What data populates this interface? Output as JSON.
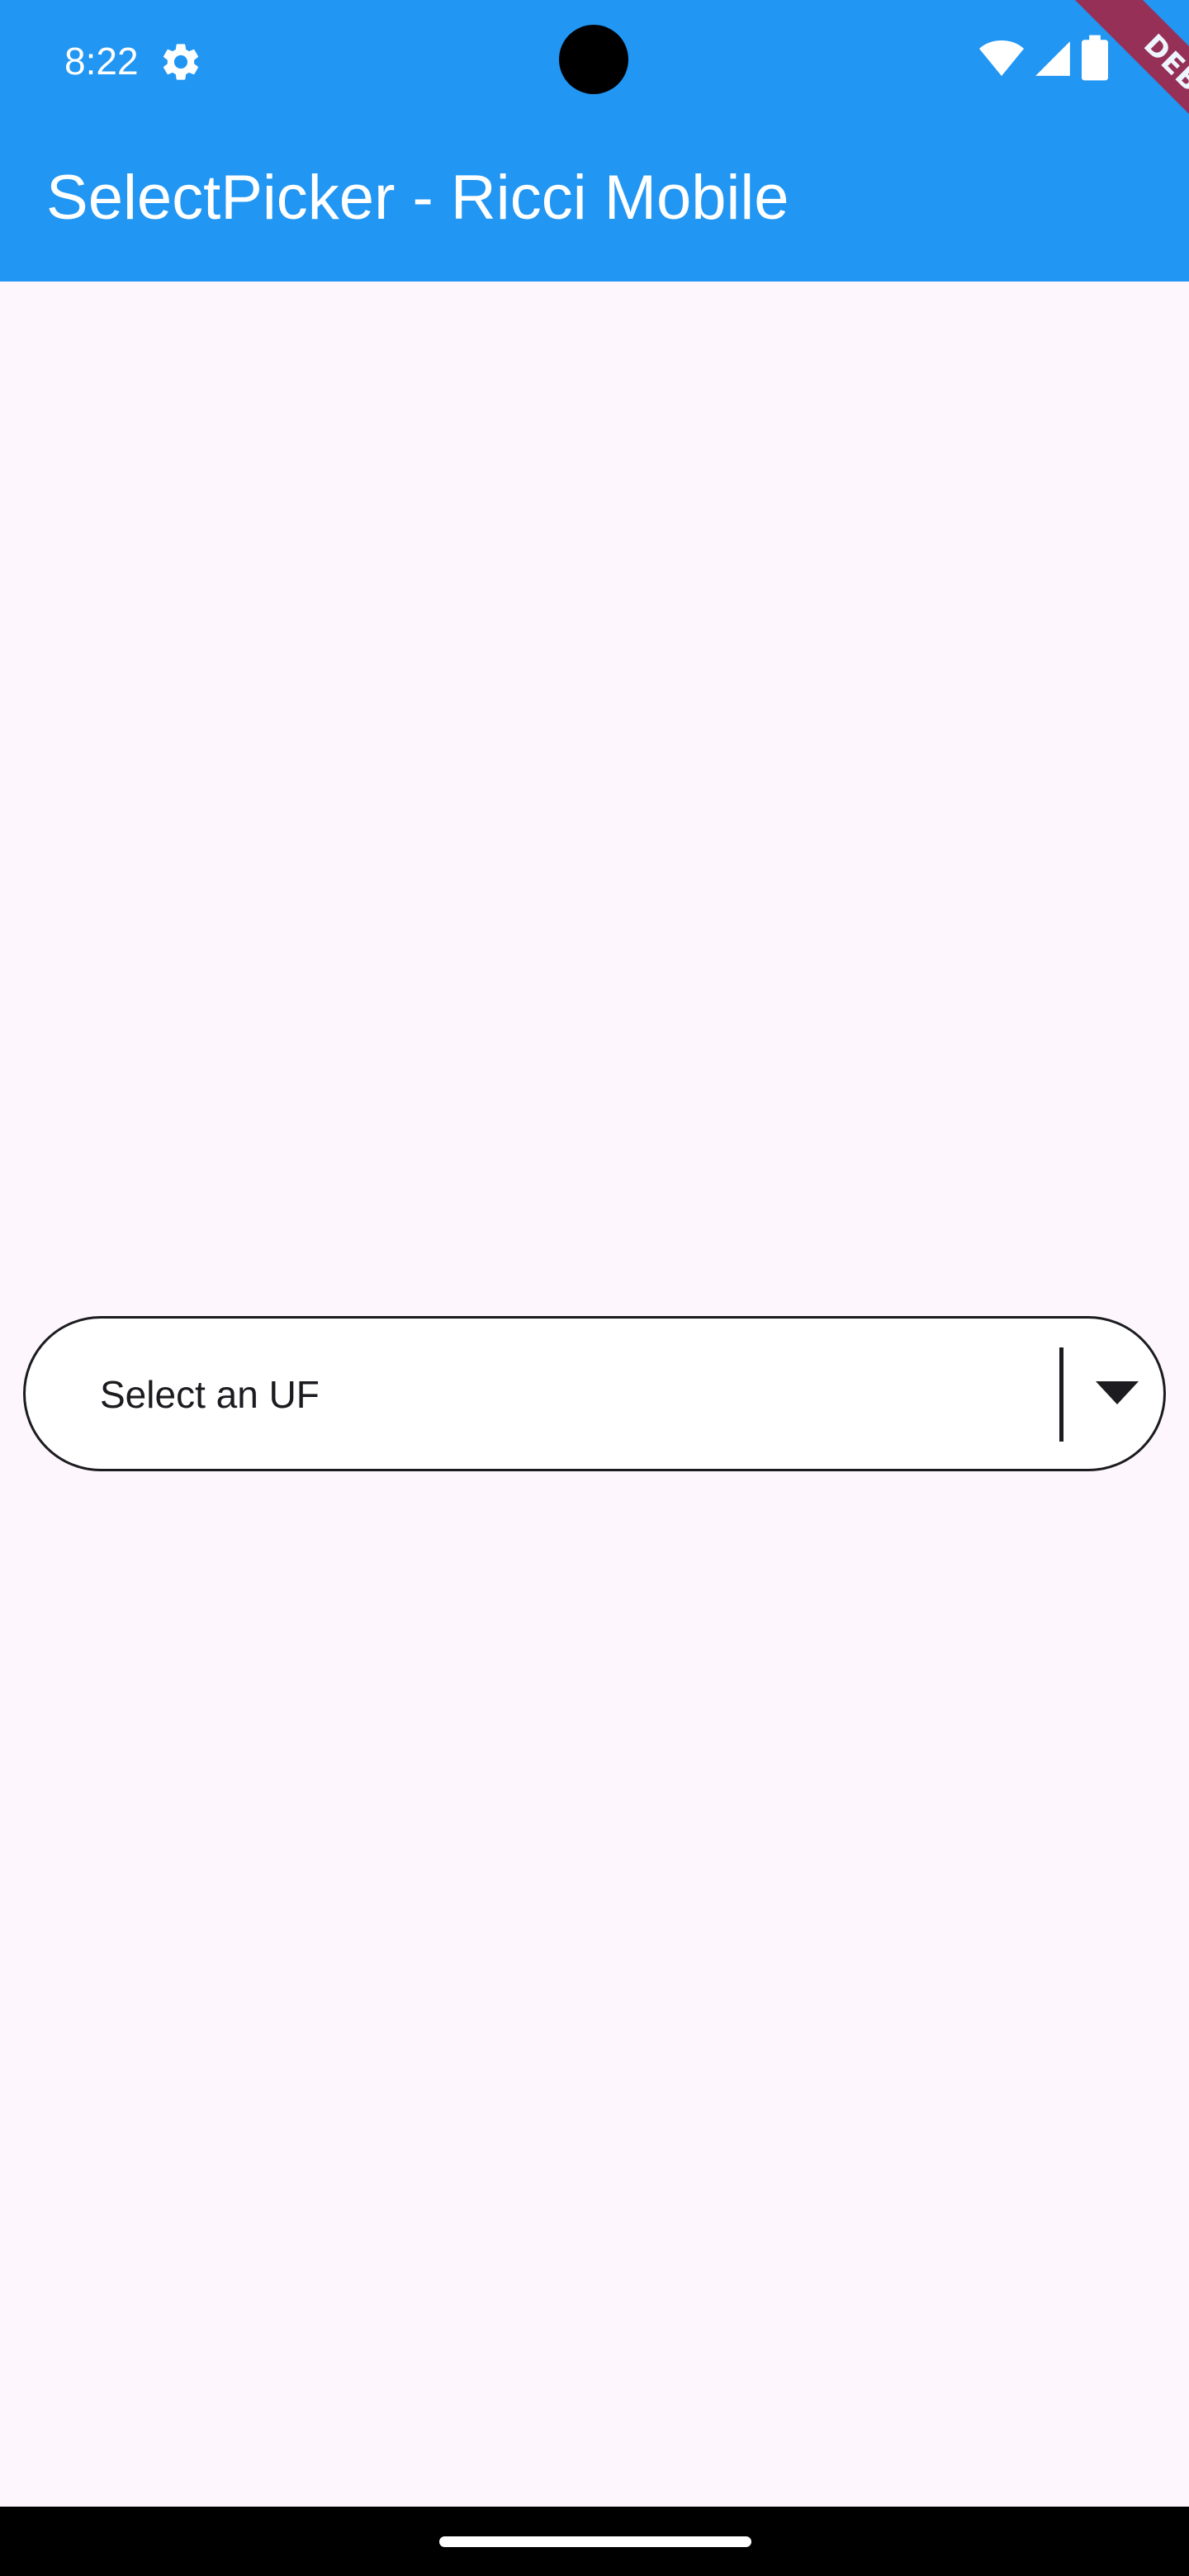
{
  "status_bar": {
    "time": "8:22",
    "icons": [
      "settings-icon",
      "wifi-icon",
      "signal-icon",
      "battery-icon"
    ]
  },
  "app_bar": {
    "title": "SelectPicker - Ricci Mobile",
    "color": "#2196f3"
  },
  "debug_banner": {
    "label": "DEBUG",
    "color": "#a0284a"
  },
  "select": {
    "placeholder": "Select an UF",
    "icon": "chevron-down-icon"
  },
  "colors": {
    "background": "#fdf7fd",
    "text": "#1c1b1f"
  }
}
